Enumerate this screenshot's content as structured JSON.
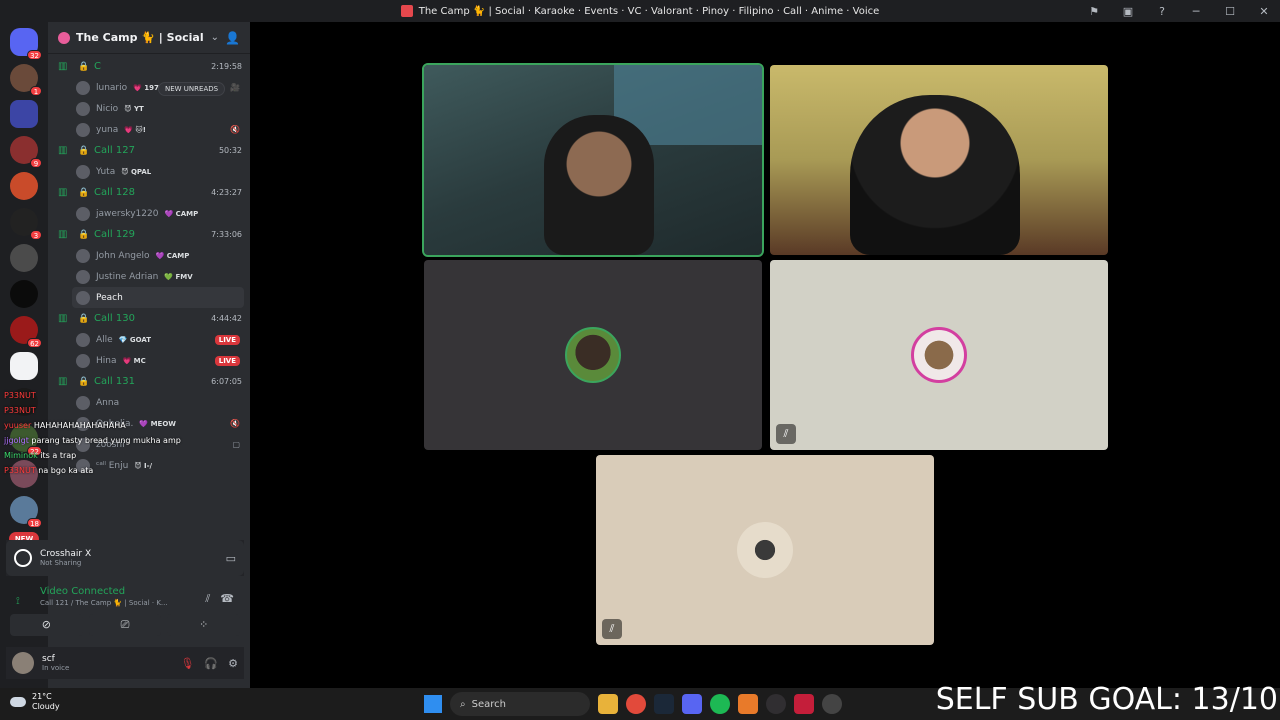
{
  "window": {
    "title": "The Camp 🐈 | Social · Karaoke · Events · VC · Valorant · Pinoy · Filipino · Call · Anime · Voice"
  },
  "server_rail": {
    "badges": [
      "32",
      "1",
      "9",
      "3",
      "62",
      "22",
      "18",
      "1"
    ],
    "new_label": "NEW"
  },
  "guild": {
    "name": "The Camp 🐈 | Social ..."
  },
  "new_unreads": "NEW UNREADS",
  "voice_channels": [
    {
      "name": "C",
      "time": "2:19:58",
      "members": [
        {
          "name": "lunario",
          "tag": "💗 1975",
          "right": "🎥"
        },
        {
          "name": "Nicio",
          "tag": "😈 YT",
          "right": ""
        },
        {
          "name": "yuna",
          "tag": "💗 🐱!",
          "right": "🔇"
        }
      ]
    },
    {
      "name": "Call 127",
      "time": "50:32",
      "members": [
        {
          "name": "Yuta",
          "tag": "😈 QPAL",
          "right": ""
        }
      ]
    },
    {
      "name": "Call 128",
      "time": "4:23:27",
      "members": [
        {
          "name": "jawersky1220",
          "tag": "💜 CAMP",
          "right": ""
        }
      ]
    },
    {
      "name": "Call 129",
      "time": "7:33:06",
      "members": [
        {
          "name": "John Angelo",
          "tag": "💜 CAMP",
          "right": ""
        },
        {
          "name": "Justine Adrian",
          "tag": "💚 FMV",
          "right": ""
        },
        {
          "name": "Peach",
          "tag": "",
          "right": ""
        }
      ]
    },
    {
      "name": "Call 130",
      "time": "4:44:42",
      "members": [
        {
          "name": "Alle",
          "tag": "💎 GOAT",
          "right": "LIVE"
        },
        {
          "name": "Hina",
          "tag": "💗 MC",
          "right": "LIVE"
        }
      ]
    },
    {
      "name": "Call 131",
      "time": "6:07:05",
      "members": [
        {
          "name": "Anna",
          "tag": "",
          "right": ""
        },
        {
          "name": "Ophelia.",
          "tag": "💜 MEOW",
          "right": "🔇"
        },
        {
          "name": "zooshi",
          "tag": "",
          "right": "▢"
        },
        {
          "name": "ᶜᵃˡˡ Enju",
          "tag": "😈 I-/",
          "right": ""
        }
      ]
    }
  ],
  "chat_overlay": [
    {
      "user": "P33NUT",
      "text": "",
      "color": "red"
    },
    {
      "user": "P33NUT",
      "text": "",
      "color": "red"
    },
    {
      "user": "yuuser",
      "text": "HAHAHAHAHAHAHAHA",
      "color": "red"
    },
    {
      "user": "jjgolgt",
      "text": "parang tasty bread yung mukha amp",
      "color": "purple"
    },
    {
      "user": "Miminok",
      "text": "its a trap",
      "color": "green"
    },
    {
      "user": "P33NUT",
      "text": "na bgo ka ata",
      "color": "red"
    }
  ],
  "activity": {
    "title": "Crosshair X",
    "subtitle": "Not Sharing"
  },
  "voice_status": {
    "status": "Video Connected",
    "location": "Call 121 / The Camp 🐈 | Social · K..."
  },
  "user": {
    "name": "scf",
    "status": "In voice"
  },
  "taskbar": {
    "temp": "21°C",
    "condition": "Cloudy",
    "search": "Search",
    "overlay": "SELF SUB GOAL: 13/10"
  },
  "icons": {
    "discord": "discord-icon",
    "speaker": "speaker-icon",
    "mute": "mute-icon"
  }
}
